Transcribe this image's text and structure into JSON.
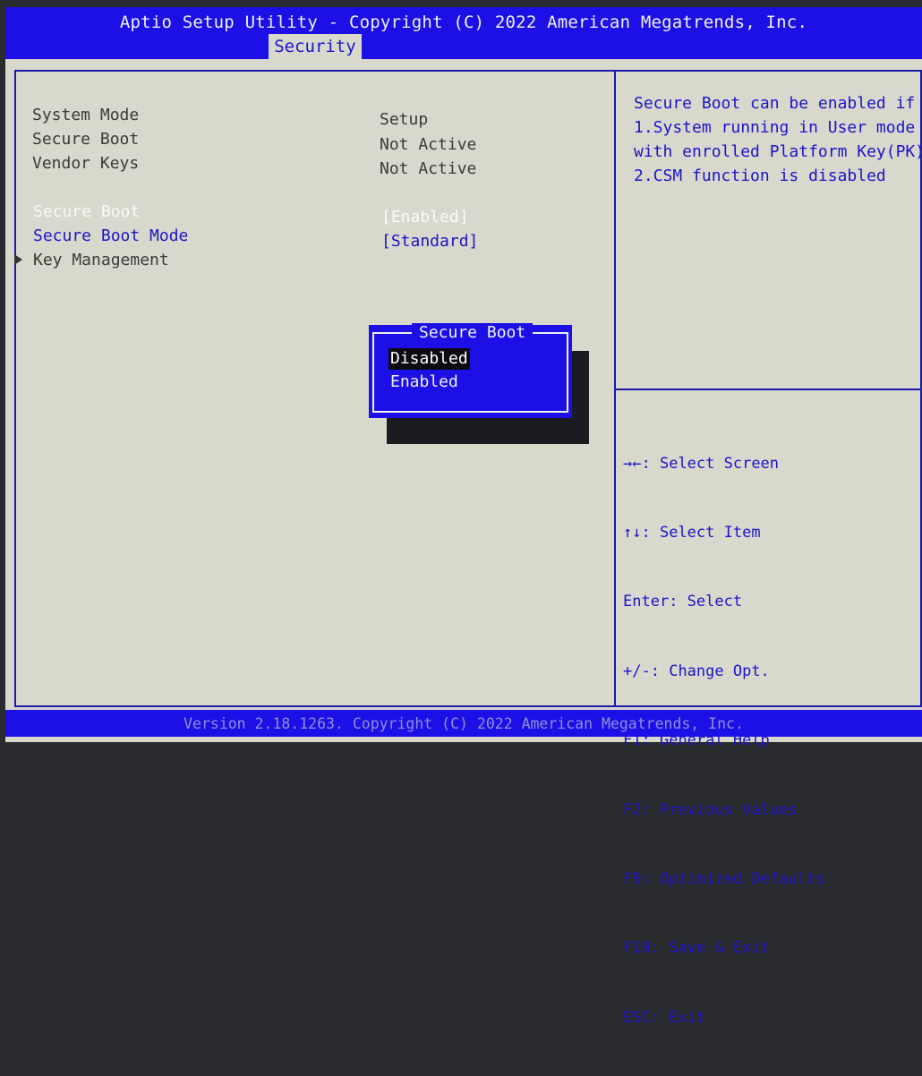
{
  "header": {
    "title": "Aptio Setup Utility - Copyright (C) 2022 American Megatrends, Inc.",
    "active_tab": "Security"
  },
  "info_rows": [
    {
      "label": "System Mode",
      "value": "Setup"
    },
    {
      "label": "Secure Boot",
      "value": "Not Active"
    },
    {
      "label": "Vendor Keys",
      "value": "Not Active"
    }
  ],
  "settings": [
    {
      "label": "Secure Boot",
      "value": "[Enabled]",
      "state": "selected"
    },
    {
      "label": "Secure Boot Mode",
      "value": "[Standard]",
      "state": "normal"
    },
    {
      "label": "Key Management",
      "value": "",
      "state": "submenu",
      "icon": "triangle-right-icon"
    }
  ],
  "help_text": "Secure Boot can be enabled if\n1.System running in User mode\nwith enrolled Platform Key(PK)\n2.CSM function is disabled",
  "key_legend": [
    {
      "key": "→←",
      "action": "Select Screen"
    },
    {
      "key": "↑↓",
      "action": "Select Item"
    },
    {
      "key": "Enter",
      "action": "Select"
    },
    {
      "key": "+/-",
      "action": "Change Opt."
    },
    {
      "key": "F1",
      "action": "General Help"
    },
    {
      "key": "F2",
      "action": "Previous Values"
    },
    {
      "key": "F9",
      "action": "Optimized Defaults"
    },
    {
      "key": "F10",
      "action": "Save & Exit"
    },
    {
      "key": "ESC",
      "action": "Exit"
    }
  ],
  "popup": {
    "title": "Secure Boot",
    "options": [
      "Disabled",
      "Enabled"
    ],
    "highlighted": "Disabled"
  },
  "footer": "Version 2.18.1263. Copyright (C) 2022 American Megatrends, Inc.",
  "colors": {
    "bios_blue": "#1c10e6",
    "background": "#d9d8cc",
    "text_blue": "#1c14c8",
    "selected_text": "#fbfbf5"
  }
}
